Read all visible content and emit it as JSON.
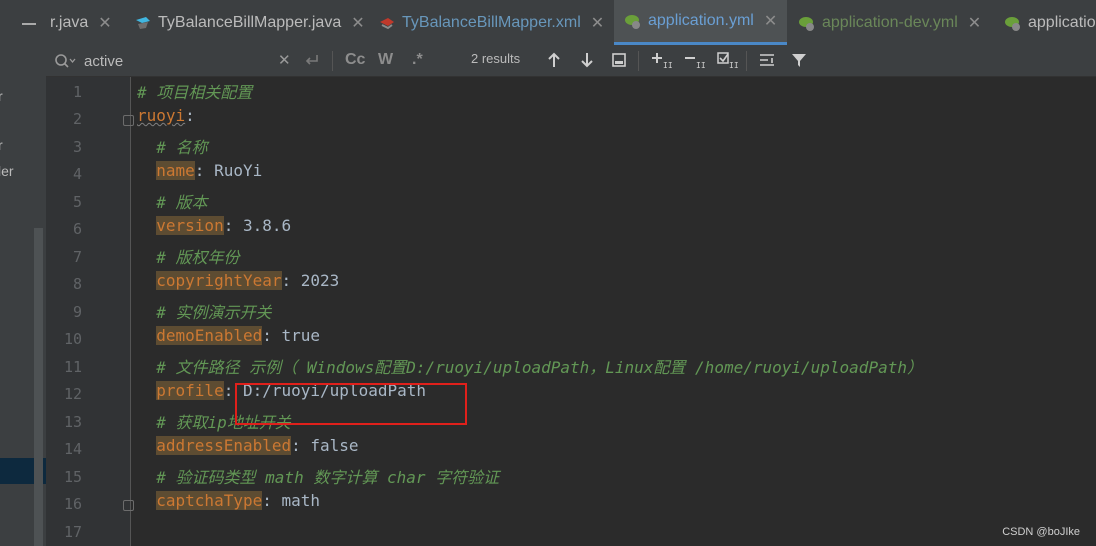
{
  "project_panel": {
    "fragments": [
      "r",
      "r",
      "ler"
    ]
  },
  "tabs": [
    {
      "label": "r.java",
      "icon": "java-file-icon",
      "active": false
    },
    {
      "label": "TyBalanceBillMapper.java",
      "icon": "mapper-interface-icon",
      "active": false
    },
    {
      "label": "TyBalanceBillMapper.xml",
      "icon": "mybatis-xml-icon",
      "active": false
    },
    {
      "label": "application.yml",
      "icon": "spring-yaml-icon",
      "active": true
    },
    {
      "label": "application-dev.yml",
      "icon": "spring-yaml-icon",
      "active": false
    },
    {
      "label": "applicatio",
      "icon": "spring-yaml-icon",
      "active": false
    }
  ],
  "search": {
    "value": "active",
    "results": "2 results",
    "case_label": "Cc",
    "word_label": "W",
    "regex_label": ".*"
  },
  "editor": {
    "line_numbers": [
      "1",
      "2",
      "3",
      "4",
      "5",
      "6",
      "7",
      "8",
      "9",
      "10",
      "11",
      "12",
      "13",
      "14",
      "15",
      "16",
      "17"
    ],
    "lines": [
      {
        "comment": "# 项目相关配置"
      },
      {
        "key": "ruoyi",
        "sep": ":"
      },
      {
        "comment": "  # 名称"
      },
      {
        "key": "name",
        "sep": ": ",
        "value": "RuoYi"
      },
      {
        "comment": "  # 版本"
      },
      {
        "key": "version",
        "sep": ": ",
        "value": "3.8.6"
      },
      {
        "comment": "  # 版权年份"
      },
      {
        "key": "copyrightYear",
        "sep": ": ",
        "value": "2023"
      },
      {
        "comment": "  # 实例演示开关"
      },
      {
        "key": "demoEnabled",
        "sep": ": ",
        "value": "true"
      },
      {
        "comment": "  # 文件路径 示例（ Windows配置D:/ruoyi/uploadPath，Linux配置 /home/ruoyi/uploadPath）"
      },
      {
        "key": "profile",
        "sep": ": ",
        "value": "D:/ruoyi/uploadPath"
      },
      {
        "comment": "  # 获取ip地址开关"
      },
      {
        "key": "addressEnabled",
        "sep": ": ",
        "value": "false"
      },
      {
        "comment": "  # 验证码类型 math 数字计算 char 字符验证"
      },
      {
        "key": "captchaType",
        "sep": ": ",
        "value": "math"
      },
      {
        "comment": ""
      }
    ]
  },
  "watermark": "CSDN @boJIke",
  "colors": {
    "background": "#2b2b2b",
    "comment": "#629755",
    "key": "#cc7832",
    "annotation_box": "#e0201b"
  }
}
